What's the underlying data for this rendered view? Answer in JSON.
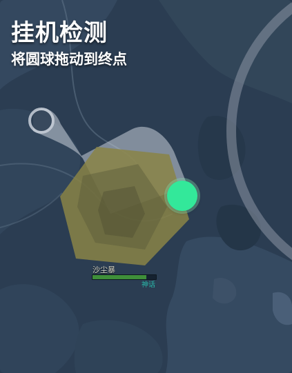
{
  "header": {
    "title": "挂机检测",
    "subtitle": "将圆球拖动到终点"
  },
  "unit": {
    "name": "沙尘暴",
    "status": "神话",
    "health_fraction": 0.85
  },
  "colors": {
    "background": "#2b3d52",
    "handle": "#33e89a",
    "target_hexagon": "#8a8446",
    "drag_track": "#b9c1cd"
  }
}
